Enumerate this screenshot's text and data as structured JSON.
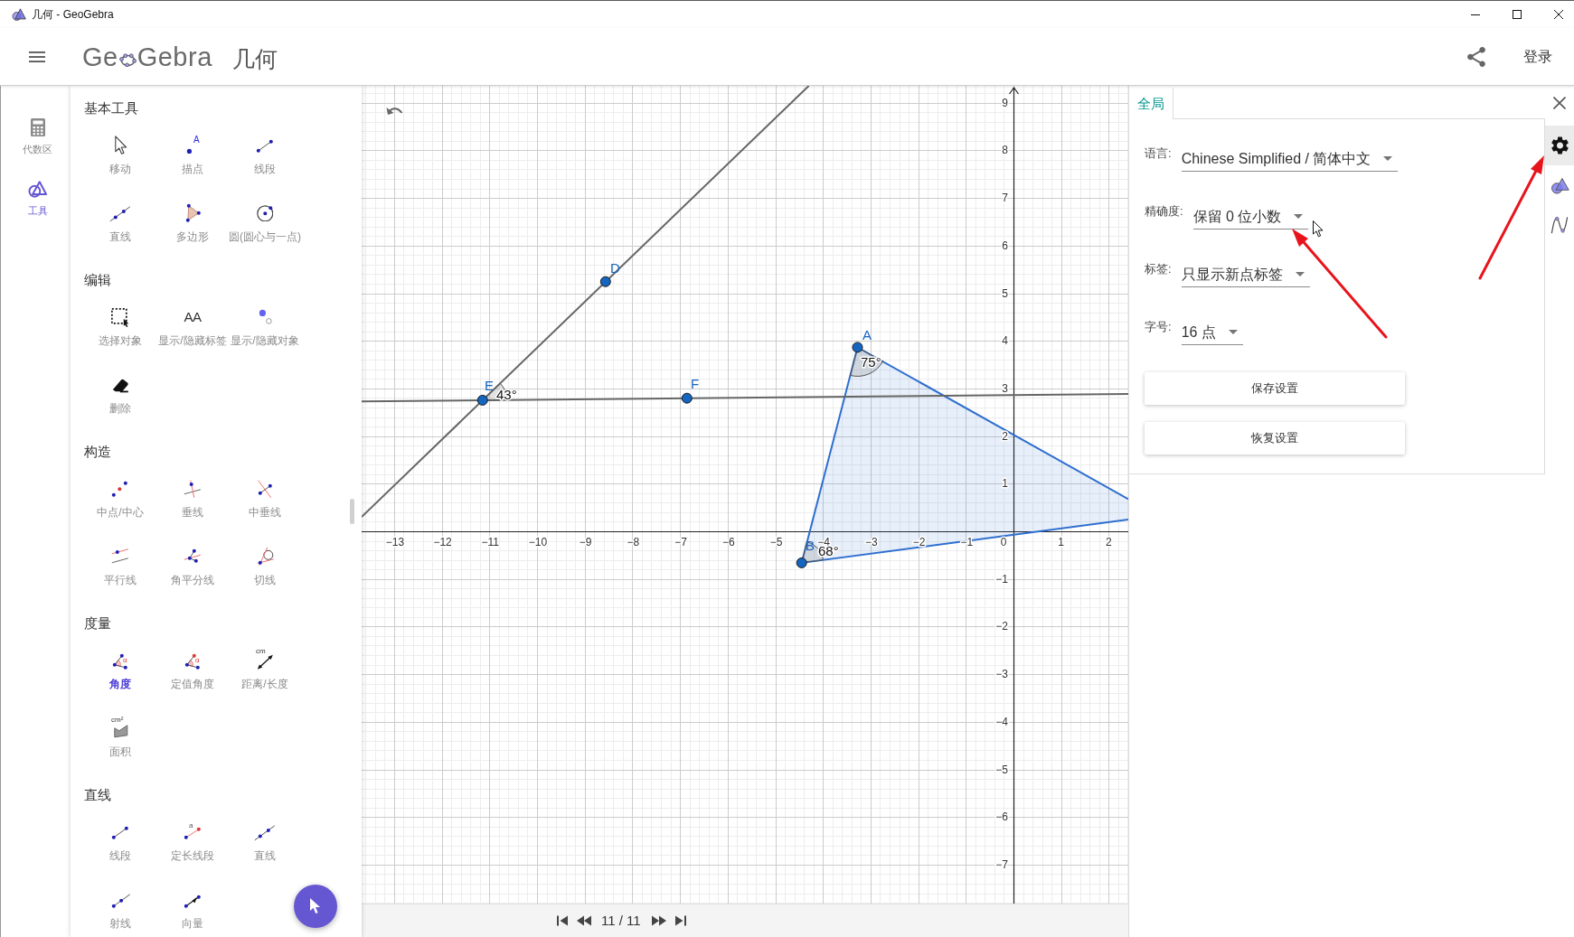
{
  "window": {
    "title": "几何 - GeoGebra"
  },
  "header": {
    "logo_start": "Ge",
    "logo_end": "Gebra",
    "app_name": "几何",
    "login": "登录"
  },
  "nav": [
    {
      "label": "代数区",
      "selected": false
    },
    {
      "label": "工具",
      "selected": true
    }
  ],
  "tool_sections": [
    {
      "title": "基本工具",
      "tools": [
        {
          "label": "移动",
          "selected": false
        },
        {
          "label": "描点",
          "icon_text": "A",
          "selected": false
        },
        {
          "label": "线段",
          "selected": false
        },
        {
          "label": "直线",
          "selected": false
        },
        {
          "label": "多边形",
          "selected": false
        },
        {
          "label": "圆(圆心与一点)",
          "selected": false
        }
      ]
    },
    {
      "title": "编辑",
      "tools": [
        {
          "label": "选择对象",
          "selected": false
        },
        {
          "label": "显示/隐藏标签",
          "icon_text": "AA",
          "selected": false
        },
        {
          "label": "显示/隐藏对象",
          "selected": false
        },
        {
          "label": "删除",
          "selected": false
        }
      ]
    },
    {
      "title": "构造",
      "tools": [
        {
          "label": "中点/中心",
          "selected": false
        },
        {
          "label": "垂线",
          "selected": false
        },
        {
          "label": "中垂线",
          "selected": false
        },
        {
          "label": "平行线",
          "selected": false
        },
        {
          "label": "角平分线",
          "selected": false
        },
        {
          "label": "切线",
          "selected": false
        }
      ]
    },
    {
      "title": "度量",
      "tools": [
        {
          "label": "角度",
          "icon_text": "α",
          "selected": true
        },
        {
          "label": "定值角度",
          "icon_text": "α",
          "selected": false
        },
        {
          "label": "距离/长度",
          "icon_text": "cm",
          "selected": false
        },
        {
          "label": "面积",
          "icon_text": "cm²",
          "selected": false
        }
      ]
    },
    {
      "title": "直线",
      "tools": [
        {
          "label": "线段",
          "selected": false
        },
        {
          "label": "定长线段",
          "icon_text": "a",
          "selected": false
        },
        {
          "label": "直线",
          "selected": false
        },
        {
          "label": "射线",
          "selected": false
        },
        {
          "label": "向量",
          "selected": false
        }
      ]
    }
  ],
  "graphics": {
    "x_axis_labels": [
      "−13",
      "−12",
      "−11",
      "−10",
      "−9",
      "−8",
      "−7",
      "−6",
      "−5",
      "−4",
      "−3",
      "−2",
      "−1",
      "0",
      "1",
      "2"
    ],
    "y_axis_labels": [
      "9",
      "8",
      "7",
      "6",
      "5",
      "4",
      "3",
      "2",
      "1",
      "−1",
      "−2",
      "−3",
      "−4",
      "−5",
      "−6",
      "−7"
    ],
    "points": [
      {
        "label": "A"
      },
      {
        "label": "B"
      },
      {
        "label": "D"
      },
      {
        "label": "E"
      },
      {
        "label": "F"
      }
    ],
    "angles": [
      {
        "label": "75°"
      },
      {
        "label": "68°"
      },
      {
        "label": "43°"
      }
    ]
  },
  "playback": {
    "position": "11 / 11"
  },
  "settings": {
    "tabs": [
      {
        "label": "全局",
        "selected": true
      }
    ],
    "categories": [
      {
        "selected": true
      },
      {
        "selected": false
      },
      {
        "selected": false
      }
    ],
    "fields": [
      {
        "label": "语言:",
        "value": "Chinese Simplified / 简体中文"
      },
      {
        "label": "精确度:",
        "value": "保留 0 位小数"
      },
      {
        "label": "标签:",
        "value": "只显示新点标签"
      },
      {
        "label": "字号:",
        "value": "16 点"
      }
    ],
    "buttons": [
      "保存设置",
      "恢复设置"
    ]
  }
}
